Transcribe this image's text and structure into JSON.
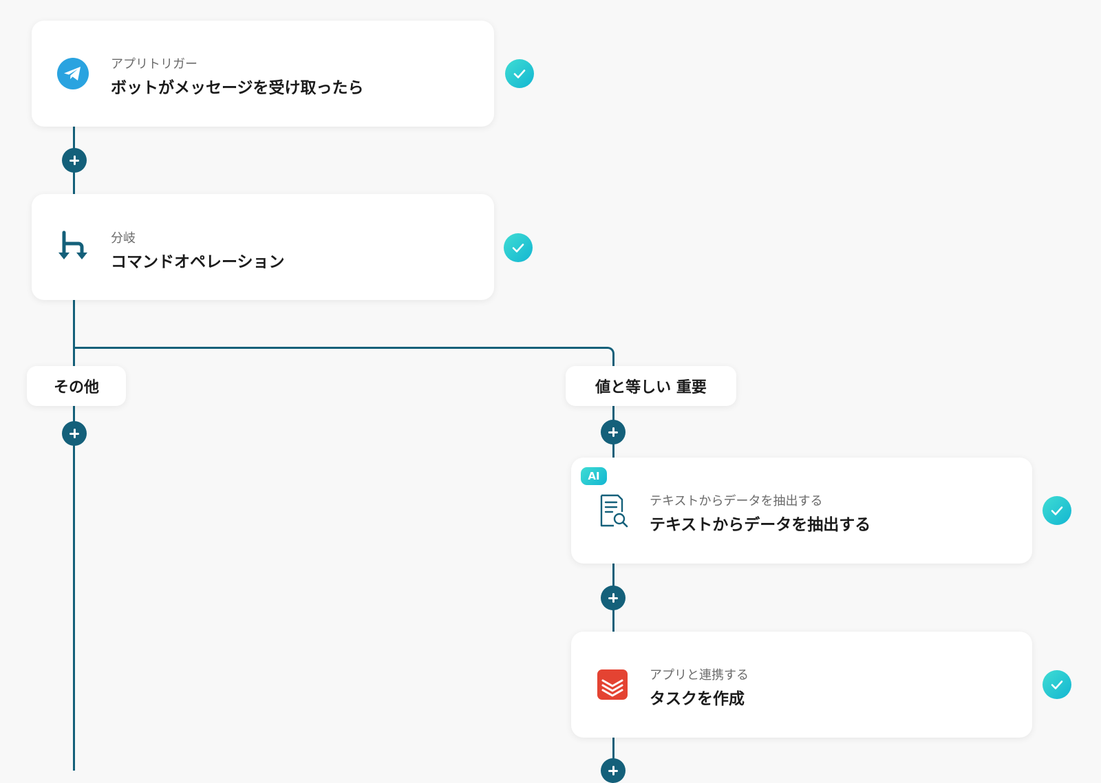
{
  "steps": {
    "trigger": {
      "subtitle": "アプリトリガー",
      "title": "ボットがメッセージを受け取ったら",
      "icon": "telegram-icon",
      "status_icon": "check-icon"
    },
    "branch": {
      "subtitle": "分岐",
      "title": "コマンドオペレーション",
      "icon": "branch-icon",
      "status_icon": "check-icon"
    },
    "extract": {
      "badge": "AI",
      "subtitle": "テキストからデータを抽出する",
      "title": "テキストからデータを抽出する",
      "icon": "document-search-icon",
      "status_icon": "check-icon"
    },
    "create_task": {
      "subtitle": "アプリと連携する",
      "title": "タスクを作成",
      "icon": "todoist-icon",
      "status_icon": "check-icon"
    }
  },
  "branches": {
    "other": "その他",
    "important": "値と等しい 重要"
  },
  "colors": {
    "connector": "#14607a",
    "check_gradient_start": "#3fdcd3",
    "check_gradient_end": "#13b6d2",
    "telegram_blue": "#2aa3e0",
    "todoist_red": "#e44332",
    "background": "#f8f8f8"
  }
}
